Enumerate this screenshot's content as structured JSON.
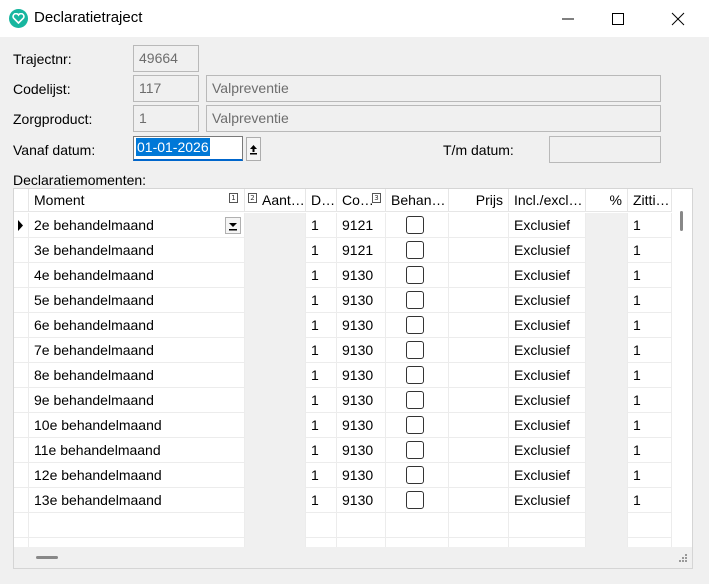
{
  "window": {
    "title": "Declaratietraject"
  },
  "form": {
    "trajectnr": {
      "label": "Trajectnr:",
      "value": "49664"
    },
    "codelijst": {
      "label": "Codelijst:",
      "code": "117",
      "name": "Valpreventie"
    },
    "zorgproduct": {
      "label": "Zorgproduct:",
      "code": "1",
      "name": "Valpreventie"
    },
    "vanaf": {
      "label": "Vanaf datum:",
      "value": "01-01-2026"
    },
    "tm": {
      "label": "T/m datum:",
      "value": ""
    },
    "grid_label": "Declaratiemomenten:"
  },
  "grid": {
    "columns": [
      "Moment",
      "Aant…",
      "D…",
      "Co…",
      "Behan…",
      "Prijs",
      "Incl./excl…",
      "%",
      "Zitti…"
    ],
    "rows": [
      {
        "moment": "2e behandelmaand",
        "aantal": "",
        "d": "1",
        "code": "9121",
        "behandeld": false,
        "prijs": "",
        "incl": "Exclusief",
        "pct": "",
        "zitting": "1"
      },
      {
        "moment": "3e behandelmaand",
        "aantal": "",
        "d": "1",
        "code": "9121",
        "behandeld": false,
        "prijs": "",
        "incl": "Exclusief",
        "pct": "",
        "zitting": "1"
      },
      {
        "moment": "4e behandelmaand",
        "aantal": "",
        "d": "1",
        "code": "9130",
        "behandeld": false,
        "prijs": "",
        "incl": "Exclusief",
        "pct": "",
        "zitting": "1"
      },
      {
        "moment": "5e behandelmaand",
        "aantal": "",
        "d": "1",
        "code": "9130",
        "behandeld": false,
        "prijs": "",
        "incl": "Exclusief",
        "pct": "",
        "zitting": "1"
      },
      {
        "moment": "6e behandelmaand",
        "aantal": "",
        "d": "1",
        "code": "9130",
        "behandeld": false,
        "prijs": "",
        "incl": "Exclusief",
        "pct": "",
        "zitting": "1"
      },
      {
        "moment": "7e behandelmaand",
        "aantal": "",
        "d": "1",
        "code": "9130",
        "behandeld": false,
        "prijs": "",
        "incl": "Exclusief",
        "pct": "",
        "zitting": "1"
      },
      {
        "moment": "8e behandelmaand",
        "aantal": "",
        "d": "1",
        "code": "9130",
        "behandeld": false,
        "prijs": "",
        "incl": "Exclusief",
        "pct": "",
        "zitting": "1"
      },
      {
        "moment": "9e behandelmaand",
        "aantal": "",
        "d": "1",
        "code": "9130",
        "behandeld": false,
        "prijs": "",
        "incl": "Exclusief",
        "pct": "",
        "zitting": "1"
      },
      {
        "moment": "10e behandelmaand",
        "aantal": "",
        "d": "1",
        "code": "9130",
        "behandeld": false,
        "prijs": "",
        "incl": "Exclusief",
        "pct": "",
        "zitting": "1"
      },
      {
        "moment": "11e behandelmaand",
        "aantal": "",
        "d": "1",
        "code": "9130",
        "behandeld": false,
        "prijs": "",
        "incl": "Exclusief",
        "pct": "",
        "zitting": "1"
      },
      {
        "moment": "12e behandelmaand",
        "aantal": "",
        "d": "1",
        "code": "9130",
        "behandeld": false,
        "prijs": "",
        "incl": "Exclusief",
        "pct": "",
        "zitting": "1"
      },
      {
        "moment": "13e behandelmaand",
        "aantal": "",
        "d": "1",
        "code": "9130",
        "behandeld": false,
        "prijs": "",
        "incl": "Exclusief",
        "pct": "",
        "zitting": "1"
      }
    ]
  },
  "colors": {
    "accent": "#0078d7",
    "app_icon": "#17b69f"
  }
}
